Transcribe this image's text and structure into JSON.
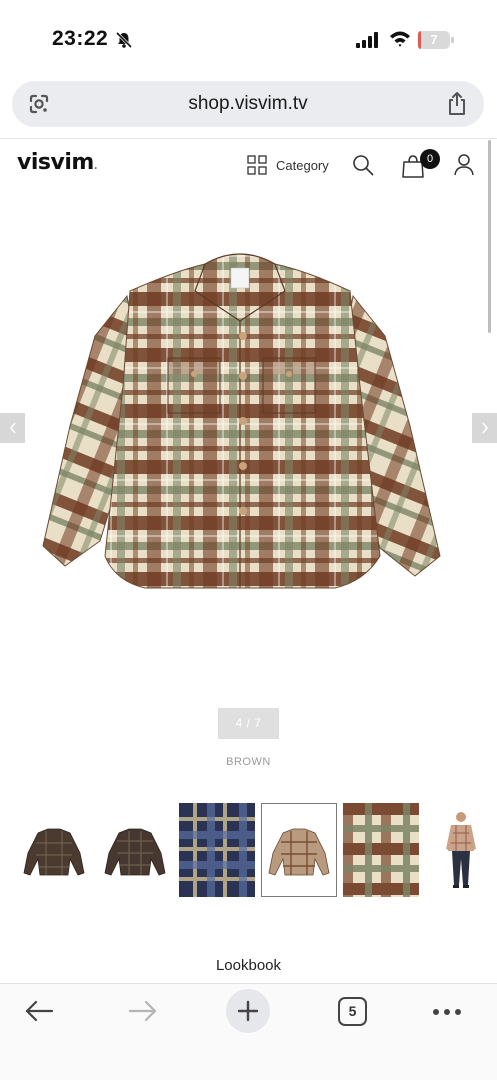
{
  "status_bar": {
    "time": "23:22",
    "battery_level": "7",
    "battery_fraction": 0.07,
    "icons": [
      "bell-slash-icon",
      "signal-icon",
      "wifi-icon",
      "battery-icon"
    ]
  },
  "address_bar": {
    "url": "shop.visvim.tv",
    "left_icon": "google-lens-icon",
    "right_icon": "share-icon"
  },
  "header": {
    "logo": "visvim",
    "logo_mark": ".",
    "category_label": "Category",
    "cart_count": "0",
    "icons": [
      "grid-icon",
      "search-icon",
      "cart-icon",
      "user-icon"
    ]
  },
  "product": {
    "image_label": "brown plaid flannel shirt",
    "counter": "4 / 7",
    "color_name": "BROWN",
    "thumbnails": [
      {
        "name": "shirt-front-dark"
      },
      {
        "name": "shirt-back-dark"
      },
      {
        "name": "navy-plaid-fabric"
      },
      {
        "name": "shirt-front-brown",
        "selected": true
      },
      {
        "name": "brown-plaid-fabric"
      },
      {
        "name": "model-wearing-shirt"
      }
    ]
  },
  "lookbook_label": "Lookbook",
  "colors": {
    "plaid_brown": "#6e3b22",
    "plaid_green": "#7d8466",
    "plaid_cream": "#e9dfc6",
    "navy": "#2a3354"
  },
  "toolbar": {
    "tab_count": "5",
    "icons": [
      "back-arrow-icon",
      "forward-arrow-icon",
      "plus-icon",
      "tabs-icon",
      "more-icon"
    ]
  }
}
